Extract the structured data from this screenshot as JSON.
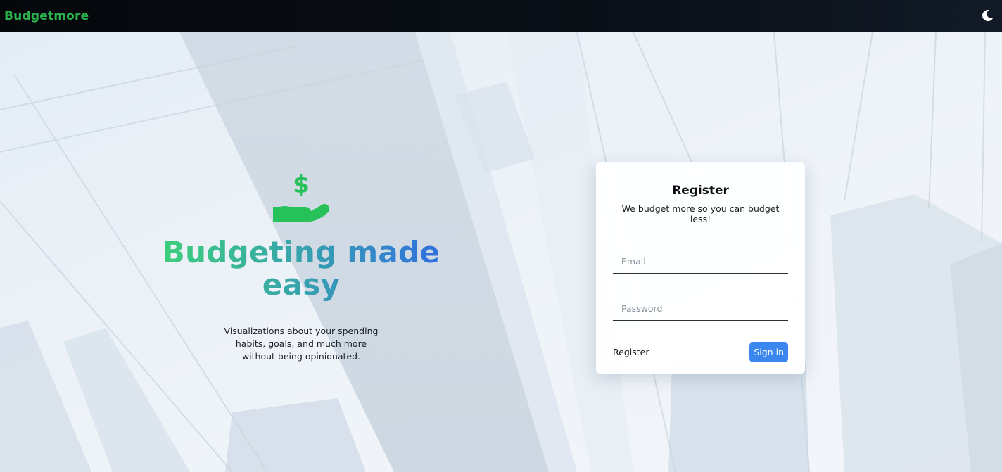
{
  "header": {
    "brand": "Budgetmore",
    "theme_icon": "moon-icon"
  },
  "hero": {
    "icon": "hand-dollar-icon",
    "headline": "Budgeting made easy",
    "tagline": "Visualizations about your spending habits, goals, and much more without being opinionated."
  },
  "register_card": {
    "title": "Register",
    "subtitle": "We budget more so you can budget less!",
    "email_placeholder": "Email",
    "email_value": "",
    "password_placeholder": "Password",
    "password_value": "",
    "register_label": "Register",
    "signin_label": "Sign in"
  },
  "colors": {
    "brand": "#2bb24c",
    "gradient_start": "#3ccf7a",
    "gradient_end": "#2f6fe0",
    "button": "#3b87ee",
    "topbar": "#05070b"
  }
}
